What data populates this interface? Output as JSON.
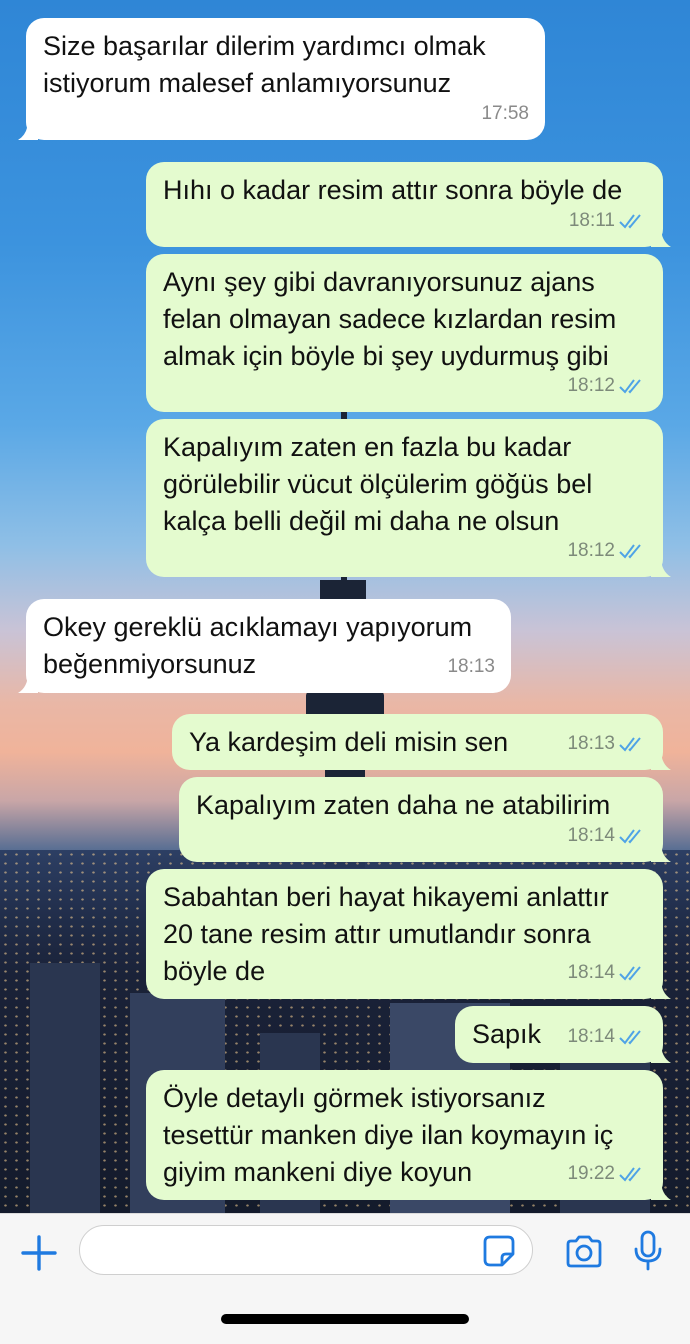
{
  "messages": [
    {
      "dir": "in",
      "text": "Size başarılar dilerim yardımcı olmak\nistiyorum malesef anlamıyorsunuz",
      "time": "17:58"
    },
    {
      "dir": "out",
      "text": "Hıhı o kadar resim attır sonra böyle de",
      "time": "18:11",
      "status": "read"
    },
    {
      "dir": "out",
      "text": "Aynı şey gibi davranıyorsunuz ajans\nfelan olmayan sadece kızlardan resim\nalmak için böyle bi şey uydurmuş gibi",
      "time": "18:12",
      "status": "read"
    },
    {
      "dir": "out",
      "text": "Kapalıyım zaten en fazla bu kadar\ngörülebilir vücut ölçülerim göğüs bel\nkalça belli değil mi daha ne olsun",
      "time": "18:12",
      "status": "read"
    },
    {
      "dir": "in",
      "text": "Okey gereklü acıklamayı yapıyorum\nbeğenmiyorsunuz",
      "time": "18:13"
    },
    {
      "dir": "out",
      "text": "Ya kardeşim deli misin sen",
      "time": "18:13",
      "status": "read"
    },
    {
      "dir": "out",
      "text": "Kapalıyım zaten daha ne atabilirim",
      "time": "18:14",
      "status": "read"
    },
    {
      "dir": "out",
      "text": "Sabahtan beri hayat hikayemi anlattır\n20 tane resim attır umutlandır sonra\nböyle de",
      "time": "18:14",
      "status": "read"
    },
    {
      "dir": "out",
      "text": "Sapık",
      "time": "18:14",
      "status": "read"
    },
    {
      "dir": "out",
      "text": "Öyle detaylı görmek istiyorsanız\ntesettür manken diye ilan koymayın iç\ngiyim mankeni diye koyun",
      "time": "19:22",
      "status": "read"
    }
  ],
  "composer": {
    "input_value": "",
    "icons": [
      "plus-icon",
      "sticker-icon",
      "camera-icon",
      "microphone-icon"
    ]
  },
  "colors": {
    "incoming_bubble": "#ffffff",
    "outgoing_bubble": "#e4fbcf",
    "read_ticks": "#4fa3e6",
    "accent": "#1f7ae0"
  }
}
